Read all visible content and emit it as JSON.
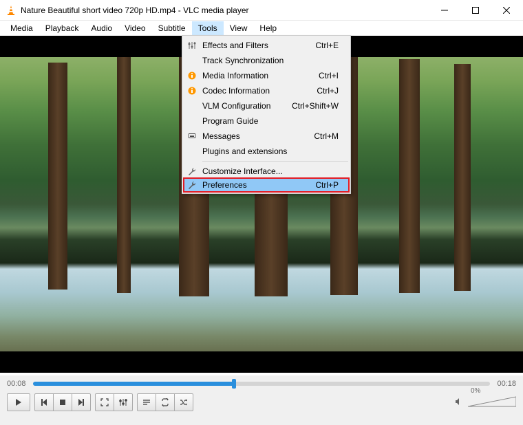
{
  "titlebar": {
    "title": "Nature Beautiful short video 720p HD.mp4 - VLC media player"
  },
  "menubar": {
    "items": [
      "Media",
      "Playback",
      "Audio",
      "Video",
      "Subtitle",
      "Tools",
      "View",
      "Help"
    ],
    "open_index": 5
  },
  "tools_menu": {
    "items": [
      {
        "icon": "sliders",
        "label": "Effects and Filters",
        "shortcut": "Ctrl+E"
      },
      {
        "icon": "",
        "label": "Track Synchronization",
        "shortcut": ""
      },
      {
        "icon": "info",
        "label": "Media Information",
        "shortcut": "Ctrl+I"
      },
      {
        "icon": "info",
        "label": "Codec Information",
        "shortcut": "Ctrl+J"
      },
      {
        "icon": "",
        "label": "VLM Configuration",
        "shortcut": "Ctrl+Shift+W"
      },
      {
        "icon": "",
        "label": "Program Guide",
        "shortcut": ""
      },
      {
        "icon": "msg",
        "label": "Messages",
        "shortcut": "Ctrl+M"
      },
      {
        "icon": "",
        "label": "Plugins and extensions",
        "shortcut": ""
      }
    ],
    "items2": [
      {
        "icon": "wrench",
        "label": "Customize Interface...",
        "shortcut": ""
      },
      {
        "icon": "wrench",
        "label": "Preferences",
        "shortcut": "Ctrl+P",
        "highlight": true
      }
    ]
  },
  "playback": {
    "current_time": "00:08",
    "total_time": "00:18",
    "volume_label": "0%"
  }
}
